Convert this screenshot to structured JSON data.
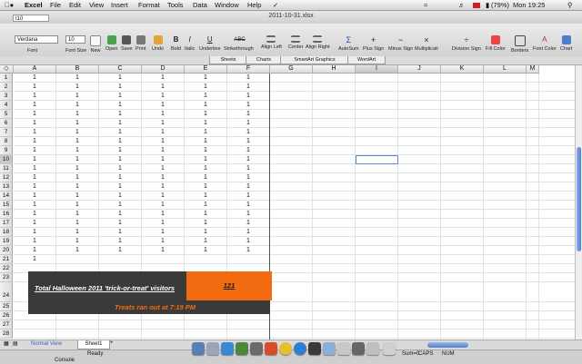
{
  "menubar": {
    "apple": "",
    "app_name": "Excel",
    "items": [
      "File",
      "Edit",
      "View",
      "Insert",
      "Format",
      "Tools",
      "Data",
      "Window",
      "Help"
    ],
    "battery": "(79%)",
    "clock": "Mon 19:25"
  },
  "window": {
    "title": "2011-10-31.xlsx"
  },
  "formula_bar": {
    "name_box": "I10"
  },
  "toolbar": {
    "font_name": "Verdana",
    "font_size": "10",
    "labels": [
      "Font",
      "Font Size",
      "New",
      "Open",
      "Save",
      "Print",
      "Undo",
      "Bold",
      "Italic",
      "Underline",
      "Strikethrough",
      "Align Left",
      "Center",
      "Align Right",
      "AutoSum",
      "Plus Sign",
      "Minus Sign",
      "Multiplicati",
      "Division Sign",
      "Fill Color",
      "Borders",
      "Font Color",
      "Chart"
    ]
  },
  "ribbon_tabs": [
    "Sheets",
    "Charts",
    "SmartArt Graphics",
    "WordArt"
  ],
  "columns": [
    "A",
    "B",
    "C",
    "D",
    "E",
    "F",
    "G",
    "H",
    "I",
    "J",
    "K",
    "L",
    "M"
  ],
  "selected_column": "I",
  "selected_row": "10",
  "rows": [
    "1",
    "2",
    "3",
    "4",
    "5",
    "6",
    "7",
    "8",
    "9",
    "10",
    "11",
    "12",
    "13",
    "14",
    "15",
    "16",
    "17",
    "18",
    "19",
    "20",
    "21",
    "22",
    "23",
    "24",
    "25",
    "26",
    "27",
    "28"
  ],
  "grid_values": [
    [
      "1",
      "1",
      "1",
      "1",
      "1",
      "1"
    ],
    [
      "1",
      "1",
      "1",
      "1",
      "1",
      "1"
    ],
    [
      "1",
      "1",
      "1",
      "1",
      "1",
      "1"
    ],
    [
      "1",
      "1",
      "1",
      "1",
      "1",
      "1"
    ],
    [
      "1",
      "1",
      "1",
      "1",
      "1",
      "1"
    ],
    [
      "1",
      "1",
      "1",
      "1",
      "1",
      "1"
    ],
    [
      "1",
      "1",
      "1",
      "1",
      "1",
      "1"
    ],
    [
      "1",
      "1",
      "1",
      "1",
      "1",
      "1"
    ],
    [
      "1",
      "1",
      "1",
      "1",
      "1",
      "1"
    ],
    [
      "1",
      "1",
      "1",
      "1",
      "1",
      "1"
    ],
    [
      "1",
      "1",
      "1",
      "1",
      "1",
      "1"
    ],
    [
      "1",
      "1",
      "1",
      "1",
      "1",
      "1"
    ],
    [
      "1",
      "1",
      "1",
      "1",
      "1",
      "1"
    ],
    [
      "1",
      "1",
      "1",
      "1",
      "1",
      "1"
    ],
    [
      "1",
      "1",
      "1",
      "1",
      "1",
      "1"
    ],
    [
      "1",
      "1",
      "1",
      "1",
      "1",
      "1"
    ],
    [
      "1",
      "1",
      "1",
      "1",
      "1",
      "1"
    ],
    [
      "1",
      "1",
      "1",
      "1",
      "1",
      "1"
    ],
    [
      "1",
      "1",
      "1",
      "1",
      "1",
      "1"
    ],
    [
      "1",
      "1",
      "1",
      "1",
      "1",
      "1"
    ],
    [
      "1",
      "",
      "",
      "",
      "",
      ""
    ]
  ],
  "summary": {
    "title": "Total Halloween 2011 'trick-or-treat' visitors",
    "count": "121",
    "note": "Treats ran out  at 7:19 PM",
    "accent_color": "#f26b10",
    "banner_color": "#3a3a3a"
  },
  "sheet_tabs": {
    "view": "Normal View",
    "sheet": "Sheet1"
  },
  "status": {
    "left": "Console",
    "mode": "Ready",
    "sum": "Sum=0",
    "caps": "CAPS",
    "num": "NUM"
  }
}
